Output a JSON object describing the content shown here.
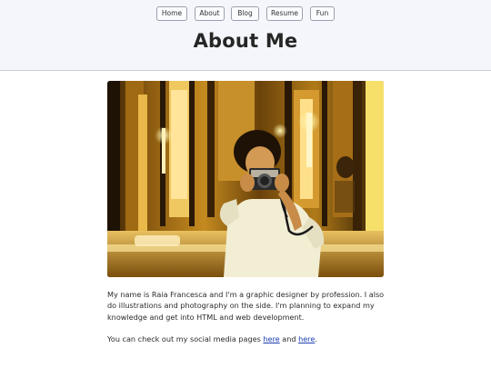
{
  "nav": {
    "items": [
      {
        "label": "Home"
      },
      {
        "label": "About"
      },
      {
        "label": "Blog"
      },
      {
        "label": "Resume"
      },
      {
        "label": "Fun"
      }
    ]
  },
  "header": {
    "title": "About Me"
  },
  "main": {
    "bio": "My name is Raia Francesca and I'm a graphic designer by profession. I also do illustrations and photography on the side. I'm planning to expand my knowledge and get into HTML and web development.",
    "social_prefix": "You can check out my social media pages",
    "link1": "here",
    "conjunction": "and",
    "link2": "here",
    "suffix": "."
  }
}
